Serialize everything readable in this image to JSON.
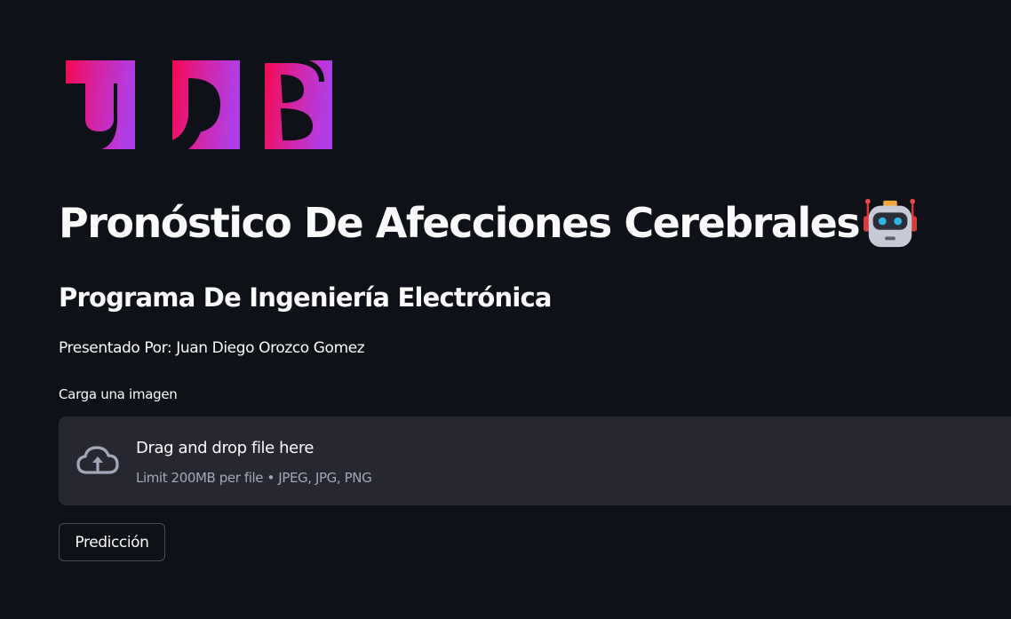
{
  "logo": {
    "text": "UDB",
    "colors": [
      "#f5094f",
      "#d226a8",
      "#b03ee8"
    ]
  },
  "header": {
    "title": "Pronóstico De Afecciones Cerebrales",
    "title_icon": "robot-icon",
    "subtitle": "Programa De Ingeniería Electrónica",
    "presenter": "Presentado Por: Juan Diego Orozco Gomez"
  },
  "uploader": {
    "label": "Carga una imagen",
    "icon": "cloud-upload-icon",
    "drop_text": "Drag and drop file here",
    "limit_text": "Limit 200MB per file • JPEG, JPG, PNG"
  },
  "actions": {
    "predict_label": "Predicción"
  },
  "theme": {
    "background": "#0e1117",
    "surface": "#262730",
    "text": "#fafafa",
    "muted_text": "#a3a8b8"
  }
}
